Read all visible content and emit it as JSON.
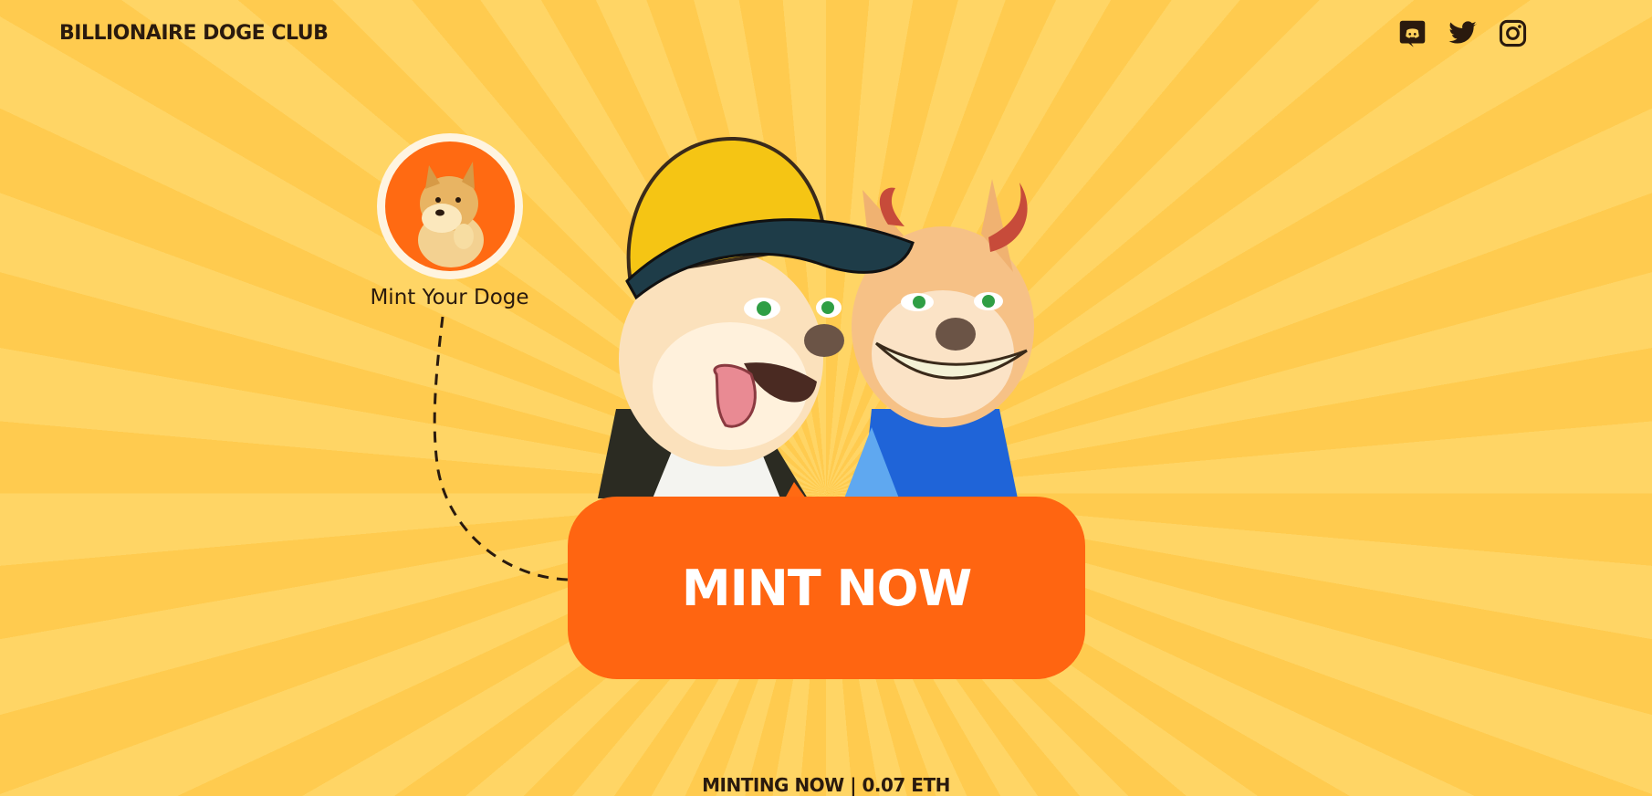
{
  "brand": {
    "title": "BILLIONAIRE DOGE CLUB"
  },
  "social": {
    "discord": "discord-icon",
    "twitter": "twitter-icon",
    "instagram": "instagram-icon"
  },
  "mint_card": {
    "label": "Mint Your Doge"
  },
  "cta": {
    "label": "MINT NOW"
  },
  "status": {
    "text": "MINTING NOW | 0.07 ETH"
  },
  "colors": {
    "background": "#ffd15c",
    "accent": "#ff6511",
    "text": "#2a1a0e"
  }
}
